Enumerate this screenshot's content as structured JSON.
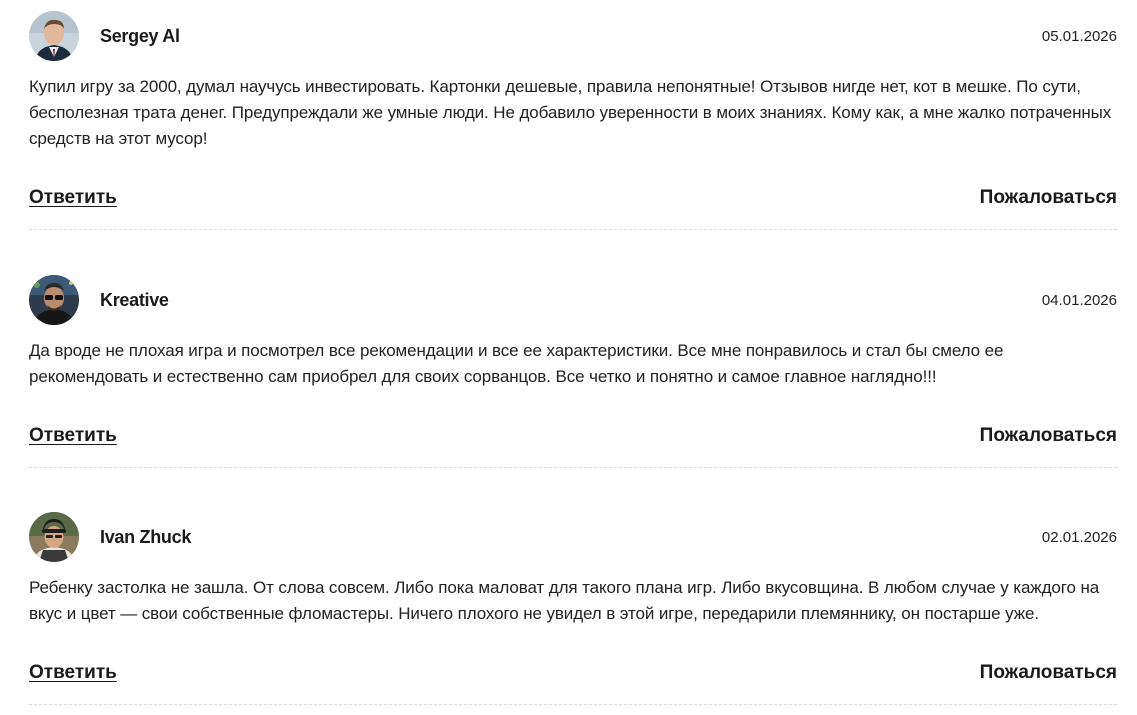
{
  "reviews": [
    {
      "author": "Sergey Al",
      "date": "05.01.2026",
      "text": "Купил игру за 2000, думал научусь инвестировать. Картонки дешевые, правила непонятные! Отзывов нигде нет, кот в мешке. По сути, бесполезная трата денег. Предупреждали же умные люди. Не добавило уверенности в моих знаниях. Кому как, а мне жалко потраченных средств на этот мусор!",
      "reply_label": "Ответить",
      "report_label": "Пожаловаться",
      "avatar_icon": "user-avatar-photo"
    },
    {
      "author": "Kreative",
      "date": "04.01.2026",
      "text": "Да вроде не плохая игра и посмотрел все рекомендации и все ее характеристики. Все мне понравилось и стал бы смело ее рекомендовать и естественно сам приобрел для своих сорванцов. Все четко и понятно и самое главное наглядно!!!",
      "reply_label": "Ответить",
      "report_label": "Пожаловаться",
      "avatar_icon": "user-avatar-photo"
    },
    {
      "author": "Ivan Zhuck",
      "date": "02.01.2026",
      "text": "Ребенку застолка не зашла. От слова совсем. Либо пока маловат для такого плана игр. Либо вкусовщина. В любом случае у каждого на вкус и цвет — свои собственные фломастеры. Ничего плохого не увидел в этой игре, передарили племяннику, он постарше уже.",
      "reply_label": "Ответить",
      "report_label": "Пожаловаться",
      "avatar_icon": "user-avatar-photo"
    }
  ],
  "colors": {
    "text": "#1a1a1a",
    "divider": "#dcdcdc"
  }
}
